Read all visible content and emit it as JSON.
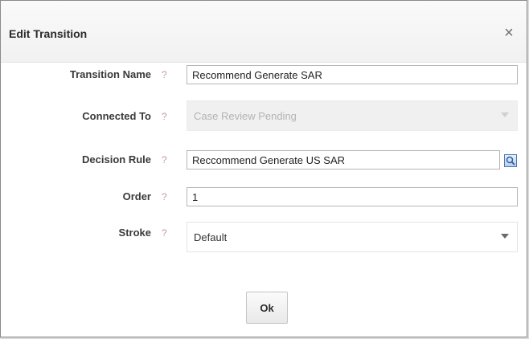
{
  "dialog": {
    "title": "Edit Transition",
    "close_glyph": "×"
  },
  "help_glyph": "?",
  "fields": {
    "transition_name": {
      "label": "Transition Name",
      "value": "Recommend Generate SAR"
    },
    "connected_to": {
      "label": "Connected To",
      "value": "Case Review Pending",
      "disabled": true
    },
    "decision_rule": {
      "label": "Decision Rule",
      "value": "Reccommend Generate US SAR"
    },
    "order": {
      "label": "Order",
      "value": "1"
    },
    "stroke": {
      "label": "Stroke",
      "value": "Default"
    }
  },
  "buttons": {
    "ok_label": "Ok"
  },
  "icons": {
    "close": "close-icon",
    "help": "help-icon",
    "lookup": "magnifier-lookup-icon",
    "dropdown": "chevron-down-icon"
  },
  "colors": {
    "header_bg": "#f4f4f4",
    "help_icon": "#c89a9a",
    "lookup_border": "#4a79b8"
  }
}
